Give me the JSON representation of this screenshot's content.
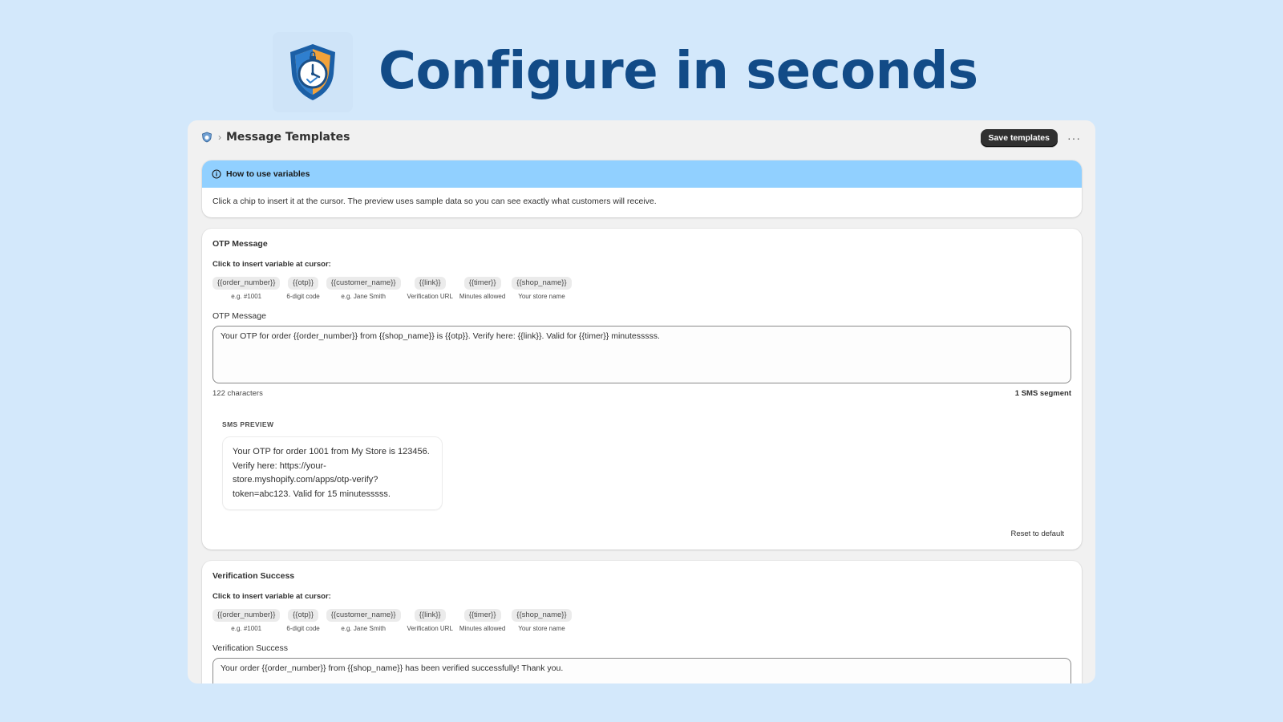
{
  "hero": {
    "title": "Configure in seconds",
    "logo_icon": "shield-clock-icon"
  },
  "colors": {
    "background": "#d3e8fb",
    "hero_title": "#124b87",
    "banner": "#91d0ff",
    "primary_button": "#303030"
  },
  "topbar": {
    "app_icon": "shield-icon",
    "separator": "›",
    "title": "Message Templates",
    "save_label": "Save templates",
    "more_label": "···"
  },
  "banner": {
    "title": "How to use variables",
    "body": "Click a chip to insert it at the cursor. The preview uses sample data so you can see exactly what customers will receive."
  },
  "variables": [
    {
      "chip": "{{order_number}}",
      "hint": "e.g. #1001"
    },
    {
      "chip": "{{otp}}",
      "hint": "6-digit code"
    },
    {
      "chip": "{{customer_name}}",
      "hint": "e.g. Jane Smith"
    },
    {
      "chip": "{{link}}",
      "hint": "Verification URL"
    },
    {
      "chip": "{{timer}}",
      "hint": "Minutes allowed"
    },
    {
      "chip": "{{shop_name}}",
      "hint": "Your store name"
    }
  ],
  "otp": {
    "section_title": "OTP Message",
    "insert_label": "Click to insert variable at cursor:",
    "field_label": "OTP Message",
    "value": "Your OTP for order {{order_number}} from {{shop_name}} is {{otp}}. Verify here: {{link}}. Valid for {{timer}} minutesssss.",
    "char_count": "122 characters",
    "segments": "1 SMS segment",
    "preview_label": "SMS PREVIEW",
    "preview_text": "Your OTP for order 1001 from My Store is 123456. Verify here: https://your-store.myshopify.com/apps/otp-verify?token=abc123. Valid for 15 minutesssss.",
    "reset_label": "Reset to default"
  },
  "success": {
    "section_title": "Verification Success",
    "insert_label": "Click to insert variable at cursor:",
    "field_label": "Verification Success",
    "value": "Your order {{order_number}} from {{shop_name}} has been verified successfully! Thank you."
  }
}
